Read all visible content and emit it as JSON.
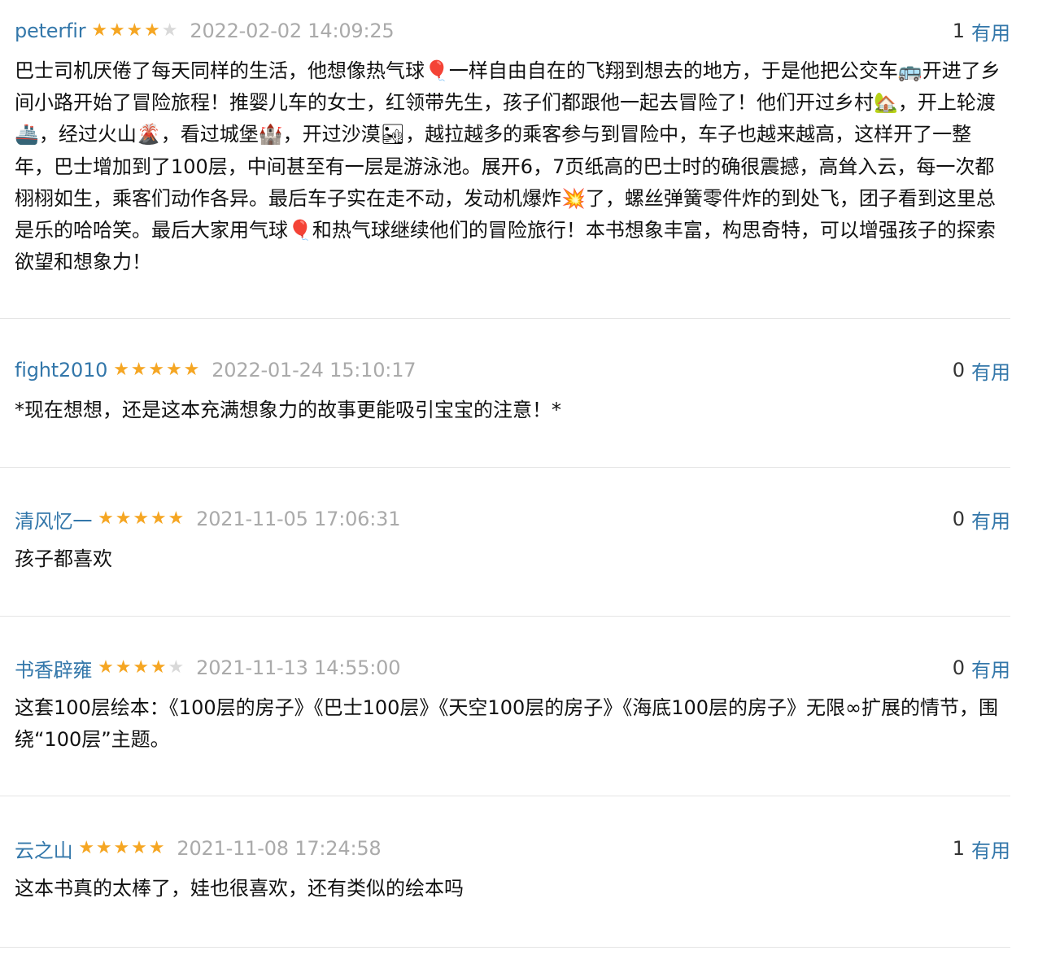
{
  "useful_label": "有用",
  "star_glyph": "★",
  "colors": {
    "link": "#3377aa",
    "star": "#f5a623",
    "star_empty": "#d9d9d9",
    "time": "#aaaaaa",
    "divider": "#e5e5e5"
  },
  "reviews": [
    {
      "reviewer": "peterfir",
      "rating": 4,
      "time": "2022-02-02 14:09:25",
      "votes": "1",
      "text": "巴士司机厌倦了每天同样的生活，他想像热气球🎈一样自由自在的飞翔到想去的地方，于是他把公交车🚌开进了乡间小路开始了冒险旅程！推婴儿车的女士，红领带先生，孩子们都跟他一起去冒险了！他们开过乡村🏡，开上轮渡🚢，经过火山🌋，看过城堡🏰，开过沙漠🏜，越拉越多的乘客参与到冒险中，车子也越来越高，这样开了一整年，巴士增加到了100层，中间甚至有一层是游泳池。展开6，7页纸高的巴士时的确很震撼，高耸入云，每一次都栩栩如生，乘客们动作各异。最后车子实在走不动，发动机爆炸💥了，螺丝弹簧零件炸的到处飞，团子看到这里总是乐的哈哈笑。最后大家用气球🎈和热气球继续他们的冒险旅行！本书想象丰富，构思奇特，可以增强孩子的探索欲望和想象力！"
    },
    {
      "reviewer": "fight2010",
      "rating": 5,
      "time": "2022-01-24 15:10:17",
      "votes": "0",
      "text": "*现在想想，还是这本充满想象力的故事更能吸引宝宝的注意！*"
    },
    {
      "reviewer": "清风忆一",
      "rating": 5,
      "time": "2021-11-05 17:06:31",
      "votes": "0",
      "text": "孩子都喜欢"
    },
    {
      "reviewer": "书香辟雍",
      "rating": 4,
      "time": "2021-11-13 14:55:00",
      "votes": "0",
      "text": "这套100层绘本：《100层的房子》《巴士100层》《天空100层的房子》《海底100层的房子》无限∞扩展的情节，围绕“100层”主题。"
    },
    {
      "reviewer": "云之山",
      "rating": 5,
      "time": "2021-11-08 17:24:58",
      "votes": "1",
      "text": "这本书真的太棒了，娃也很喜欢，还有类似的绘本吗"
    }
  ]
}
